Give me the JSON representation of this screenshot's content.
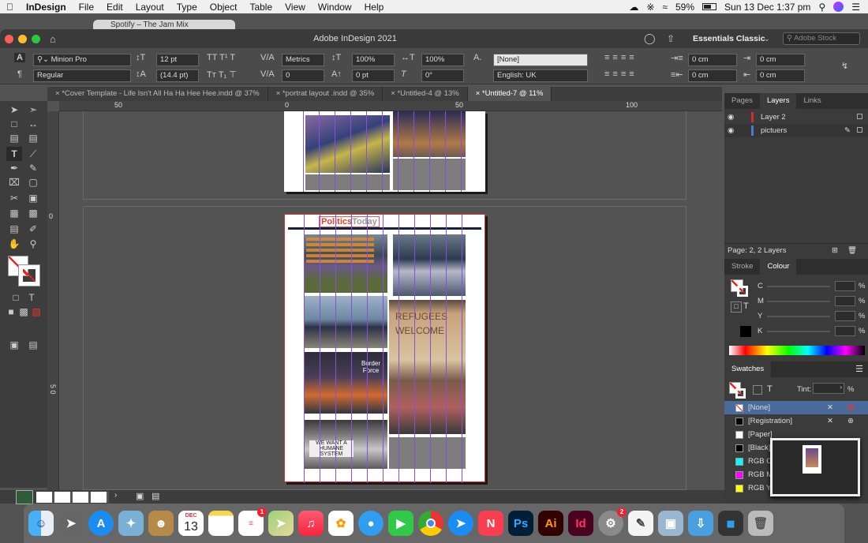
{
  "menubar": {
    "app": "InDesign",
    "items": [
      "File",
      "Edit",
      "Layout",
      "Type",
      "Object",
      "Table",
      "View",
      "Window",
      "Help"
    ],
    "battery": "59%",
    "clock": "Sun 13 Dec  1:37 pm"
  },
  "ghost_tab": "Spotify – The Jam Mix",
  "window": {
    "title": "Adobe InDesign 2021",
    "workspace": "Essentials Classic",
    "stock_placeholder": "Adobe Stock"
  },
  "control": {
    "font": "Minion Pro",
    "style": "Regular",
    "size": "12 pt",
    "leading": "(14.4 pt)",
    "kerning": "Metrics",
    "tracking": "0",
    "vscale": "100%",
    "hscale": "100%",
    "baseline": "0 pt",
    "skew": "0°",
    "char_style": "[None]",
    "language": "English: UK",
    "indent_left": "0 cm",
    "indent_right": "0 cm",
    "indent_first": "0 cm",
    "indent_last": "0 cm"
  },
  "doc_tabs": [
    "*Cover Template - Life Isn't All Ha Ha Hee Hee.indd @ 37%",
    "*portrat layout .indd @ 35%",
    "*Untitled-4 @ 13%",
    "*Untitled-7 @ 11%"
  ],
  "ruler": {
    "h": [
      "50",
      "0",
      "50",
      "100"
    ],
    "v": [
      "0",
      "5 0"
    ]
  },
  "page": {
    "header_politics": "Politics",
    "header_today": "Today",
    "sign_refugees": "REFUGEES WELCOME",
    "sign_border": "Border Force",
    "sign_want": "WE WANT A HUMANE SYSTEM"
  },
  "layers_panel": {
    "tabs": [
      "Pages",
      "Layers",
      "Links"
    ],
    "layers": [
      {
        "name": "Layer 2",
        "color": "#d22c2c"
      },
      {
        "name": "pictuers",
        "color": "#4a7bd8"
      }
    ],
    "footer": "Page: 2, 2 Layers"
  },
  "colour_panel": {
    "tabs": [
      "Stroke",
      "Colour"
    ],
    "channels": [
      "C",
      "M",
      "Y",
      "K"
    ],
    "pct": "%"
  },
  "swatches_panel": {
    "title": "Swatches",
    "tint_label": "Tint:",
    "tint_unit": "%",
    "items": [
      {
        "name": "[None]",
        "color": "#ffffff"
      },
      {
        "name": "[Registration]",
        "color": "#000000"
      },
      {
        "name": "[Paper]",
        "color": "#ffffff"
      },
      {
        "name": "[Black]",
        "color": "#000000"
      },
      {
        "name": "RGB Cy",
        "color": "#00ffff"
      },
      {
        "name": "RGB Ma",
        "color": "#ff00ff"
      },
      {
        "name": "RGB Ye",
        "color": "#ffff00"
      }
    ]
  },
  "dock": {
    "calendar_month": "DEC",
    "calendar_day": "13",
    "apps": [
      "Finder",
      "Launchpad",
      "App Store",
      "Preview",
      "Contacts",
      "Calendar",
      "Notes",
      "Reminders",
      "Maps",
      "Music",
      "Photos",
      "Messages",
      "FaceTime",
      "Chrome",
      "Safari",
      "News",
      "Photoshop",
      "Illustrator",
      "InDesign",
      "System Preferences",
      "TextEdit",
      "Preview2",
      "Downloads",
      "Trash"
    ],
    "ps": "Ps",
    "ai": "Ai",
    "id": "Id",
    "reminders_badge": "1",
    "prefs_badge": "2"
  }
}
